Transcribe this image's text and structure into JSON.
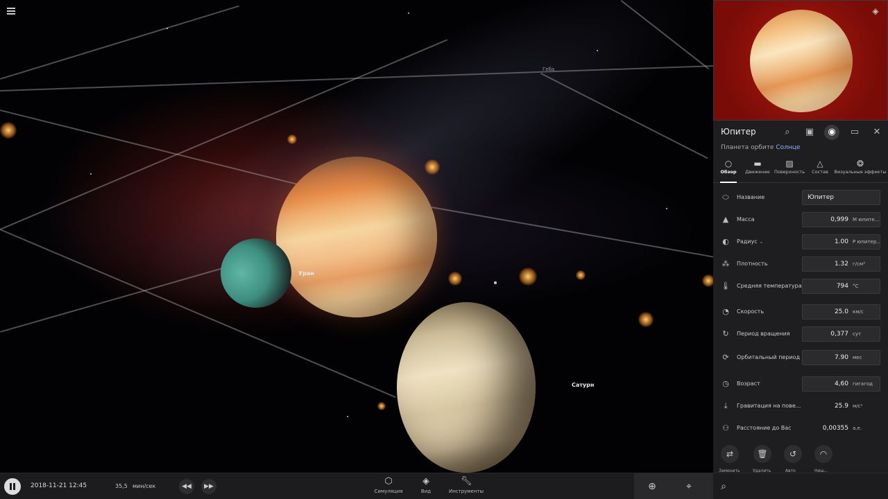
{
  "scene": {
    "labels": {
      "uranus": "Уран",
      "saturn": "Сатурн",
      "hebe": "Геба"
    }
  },
  "panel": {
    "title": "Юпитер",
    "subtitle_prefix": "Планета орбите",
    "subtitle_link": "Солнце",
    "tabs": [
      {
        "label": "Обзор",
        "icon": "circle-icon"
      },
      {
        "label": "Движение",
        "icon": "toggle-icon"
      },
      {
        "label": "Поверхность",
        "icon": "image-icon"
      },
      {
        "label": "Состав",
        "icon": "flask-icon"
      },
      {
        "label": "Визуальные эффекты",
        "icon": "palette-icon"
      }
    ],
    "properties": [
      {
        "label": "Название",
        "value": "Юпитер",
        "unit": ""
      },
      {
        "label": "Масса",
        "value": "0,999",
        "unit": "М юпите..."
      },
      {
        "label": "Радиус",
        "value": "1.00",
        "unit": "Р юпитер..."
      },
      {
        "label": "Плотность",
        "value": "1.32",
        "unit": "г/см³"
      },
      {
        "label": "Средняя температура",
        "value": "794",
        "unit": "°C"
      },
      {
        "label": "Скорость",
        "value": "25.0",
        "unit": "км/с"
      },
      {
        "label": "Период вращения",
        "value": "0,377",
        "unit": "сут"
      },
      {
        "label": "Орбитальный период",
        "value": "7.90",
        "unit": "мес"
      },
      {
        "label": "Возраст",
        "value": "4,60",
        "unit": "гигагод"
      },
      {
        "label": "Гравитация на пове...",
        "value": "25.9",
        "unit": "м/с²"
      },
      {
        "label": "Расстояние до Вас",
        "value": "0,00355",
        "unit": "а.е."
      }
    ],
    "actions": [
      "Заменить",
      "Удалить",
      "Авто",
      "Ниш..."
    ]
  },
  "bottom": {
    "datetime": "2018-11-21 12:45",
    "speed_value": "35,5",
    "speed_unit": "мин/сек",
    "nav": [
      {
        "label": "Симуляция"
      },
      {
        "label": "Вид"
      },
      {
        "label": "Инструменты"
      }
    ]
  }
}
